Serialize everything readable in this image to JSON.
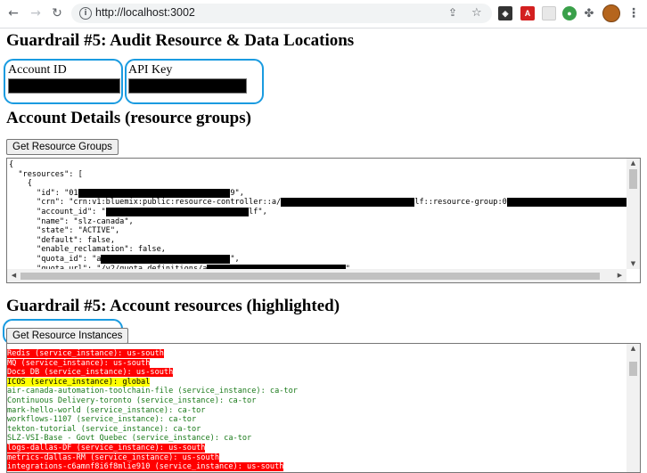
{
  "browser": {
    "url": "http://localhost:3002",
    "icons": [
      "back-arrow-icon",
      "forward-arrow-icon",
      "reload-icon",
      "info-icon",
      "share-icon",
      "bookmark-star-icon",
      "puzzle-extensions-icon",
      "profile-avatar"
    ]
  },
  "section1": {
    "title": "Guardrail #5: Audit Resource & Data Locations",
    "account_id_label": "Account ID",
    "account_id_value": "",
    "api_key_label": "API Key",
    "api_key_value": ""
  },
  "section2": {
    "title": "Account Details (resource groups)",
    "button_label": "Get Resource Groups",
    "json_lines": [
      {
        "a": "{",
        "r": "",
        "b": ""
      },
      {
        "a": "  \"resources\": [",
        "r": "",
        "b": ""
      },
      {
        "a": "    {",
        "r": "",
        "b": ""
      },
      {
        "a": "      \"id\": \"01",
        "r": "XXXXXXXXXXXXXXXXXXXXXXXXXXXXXXXXX",
        "b": "9\","
      },
      {
        "a": "      \"crn\": \"crn:v1:bluemix:public:resource-controller::a/",
        "r": "XXXXXXXXXXXXXXXXXXXXXXXXXXXXX",
        "b": "lf::resource-group:0",
        "r2": "XXXXXXXXXXXXXXXXXXXXXXXXXXXXXXXXXXXX",
        "b2": "9\","
      },
      {
        "a": "      \"account_id\": \"",
        "r": "XXXXXXXXXXXXXXXXXXXXXXXXXXXXXXX",
        "b": "lf\","
      },
      {
        "a": "      \"name\": \"slz-canada\",",
        "r": "",
        "b": ""
      },
      {
        "a": "      \"state\": \"ACTIVE\",",
        "r": "",
        "b": ""
      },
      {
        "a": "      \"default\": false,",
        "r": "",
        "b": ""
      },
      {
        "a": "      \"enable_reclamation\": false,",
        "r": "",
        "b": ""
      },
      {
        "a": "      \"quota_id\": \"a",
        "r": "XXXXXXXXXXXXXXXXXXXXXXXXXXXX",
        "b": "\","
      },
      {
        "a": "      \"quota_url\": \"/v2/quota_definitions/a",
        "r": "XXXXXXXXXXXXXXXXXXXXXXXXXXXXXX",
        "b": "\","
      }
    ]
  },
  "section3": {
    "title": "Guardrail #5: Account resources (highlighted)",
    "button_label": "Get Resource Instances",
    "resource_lines": [
      {
        "text": "Redis (service_instance): us-south",
        "status": "red"
      },
      {
        "text": "MQ (service_instance): us-south",
        "status": "red"
      },
      {
        "text": "Docs DB (service_instance): us-south",
        "status": "red"
      },
      {
        "text": "ICOS (service_instance): global",
        "status": "yellow"
      },
      {
        "text": "air-canada-automation-toolchain-file (service_instance): ca-tor",
        "status": "green"
      },
      {
        "text": "Continuous Delivery-toronto (service_instance): ca-tor",
        "status": "green"
      },
      {
        "text": "mark-hello-world (service_instance): ca-tor",
        "status": "green"
      },
      {
        "text": "workflows-1107 (service_instance): ca-tor",
        "status": "green"
      },
      {
        "text": "tekton-tutorial (service_instance): ca-tor",
        "status": "green"
      },
      {
        "text": "SLZ-VSI-Base - Govt Quebec (service_instance): ca-tor",
        "status": "green"
      },
      {
        "text": "logs-dallas-DF (service_instance): us-south",
        "status": "red"
      },
      {
        "text": "metrics-dallas-RM (service_instance): us-south",
        "status": "red"
      },
      {
        "text": "integrations-c6amnf8i6f8mlie910 (service_instance): us-south",
        "status": "red"
      }
    ]
  },
  "colors": {
    "red_bg": "#ff0000",
    "red_text": "#ffffff",
    "yellow_bg": "#ffff00",
    "yellow_text": "#000000",
    "green_text": "#1a7a1a",
    "annotation_circle": "#1a9be0"
  }
}
